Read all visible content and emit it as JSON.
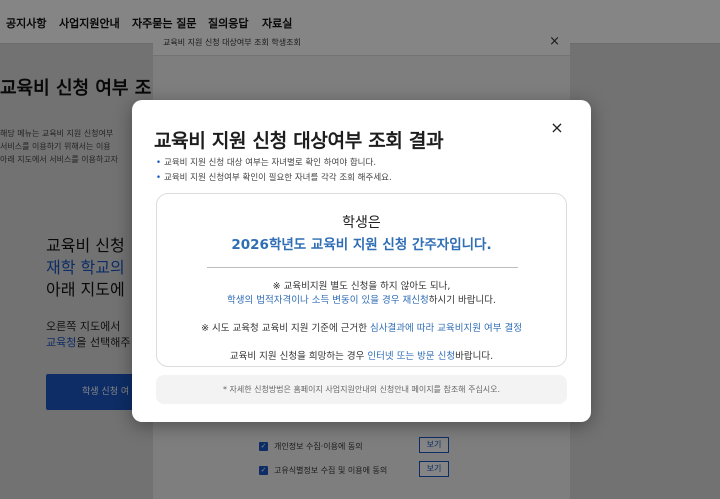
{
  "nav": {
    "items": [
      "공지사항",
      "사업지원안내",
      "자주묻는 질문",
      "질의응답",
      "자료실"
    ]
  },
  "background": {
    "title": "교육비 신청 여부 조",
    "desc": [
      "해당 메뉴는 교육비 지원 신청여부",
      "서비스를 이용하기 위해서는 이용",
      "아래 지도에서 서비스를 이용하고자"
    ],
    "big1": "교육비 신청",
    "big2": "재학 학교의",
    "big3": "아래 지도에",
    "mid1": "오른쪽 지도에서",
    "mid2": "교육청",
    "mid2_rest": "을 선택해주",
    "button": "학생 신청 여"
  },
  "mid_popup": {
    "title": "교육비 지원 신청 대상여부 조회 학생조회",
    "close": "×",
    "consents": [
      {
        "label": "개인정보 수집·이용에 동의",
        "view": "보기"
      },
      {
        "label": "고유식별정보 수집 및 이용에 동의",
        "view": "보기"
      }
    ]
  },
  "modal": {
    "title": "교육비 지원 신청 대상여부 조회 결과",
    "close": "×",
    "notes": [
      "교육비 지원 신청 대상 여부는 자녀별로 확인 하여야 합니다.",
      "교육비 지원 신청여부 확인이 필요한 자녀를 각각 조회 해주세요."
    ],
    "result_line1": "학생은",
    "result_line2": "2026학년도 교육비 지원 신청 간주자입니다.",
    "info1": "※ 교육비지원 별도 신청을 하지 않아도 되나,",
    "info2_hl": "학생의 법적자격이나 소득 변동이 있을 경우 재신청",
    "info2_rest": "하시기 바랍니다.",
    "info3_pre": "※ 시도 교육청 교육비 지원 기준에 근거한 ",
    "info3_hl": "심사결과에 따라 교육비지원 여부 결정",
    "info4_pre": "교육비 지원 신청을 희망하는 경우 ",
    "info4_hl": "인터넷 또는 방문 신청",
    "info4_rest": "바랍니다.",
    "footer": "* 자세한 신청방법은 홈페이지 사업지원안내의 신청안내 페이지를 참조해 주십시오."
  },
  "colors": {
    "accent": "#2f6db5",
    "primary_button": "#1a56c4"
  }
}
